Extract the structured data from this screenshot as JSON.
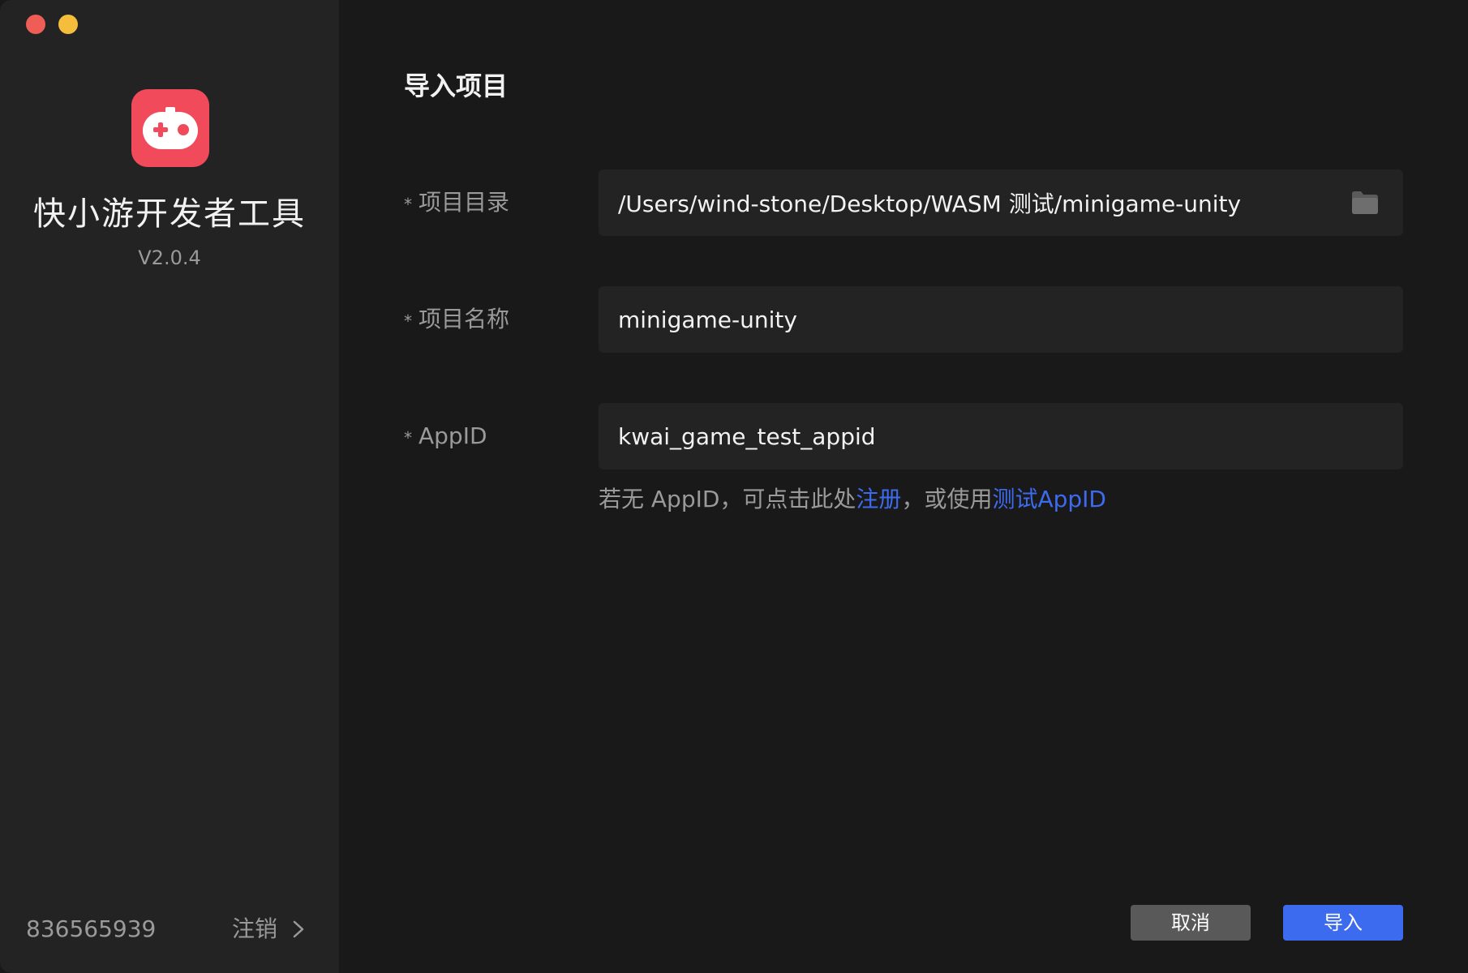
{
  "window": {
    "controls": [
      "close",
      "minimize"
    ]
  },
  "sidebar": {
    "logo_icon": "gamepad-logo-icon",
    "app_name": "快小游开发者工具",
    "version": "V2.0.4",
    "user_id": "836565939",
    "logout_label": "注销",
    "logout_icon": "chevron-right-icon"
  },
  "main": {
    "title": "导入项目",
    "fields": {
      "directory": {
        "label": "项目目录",
        "value": "/Users/wind-stone/Desktop/WASM 测试/minigame-unity",
        "icon": "folder-icon"
      },
      "name": {
        "label": "项目名称",
        "value": "minigame-unity"
      },
      "appid": {
        "label": "AppID",
        "value": "kwai_game_test_appid"
      }
    },
    "required_mark": "*",
    "hint": {
      "prefix": "若无 AppID，可点击此处",
      "register_link": "注册",
      "middle": "，或使用",
      "test_appid_link": "测试AppID"
    },
    "buttons": {
      "cancel": "取消",
      "import": "导入"
    }
  },
  "colors": {
    "background": "#191919",
    "sidebar": "#232323",
    "field": "#232323",
    "accent": "#3d6bf0",
    "logo": "#f04a5b",
    "close": "#ee5e57",
    "minimize": "#f5bd3c"
  }
}
